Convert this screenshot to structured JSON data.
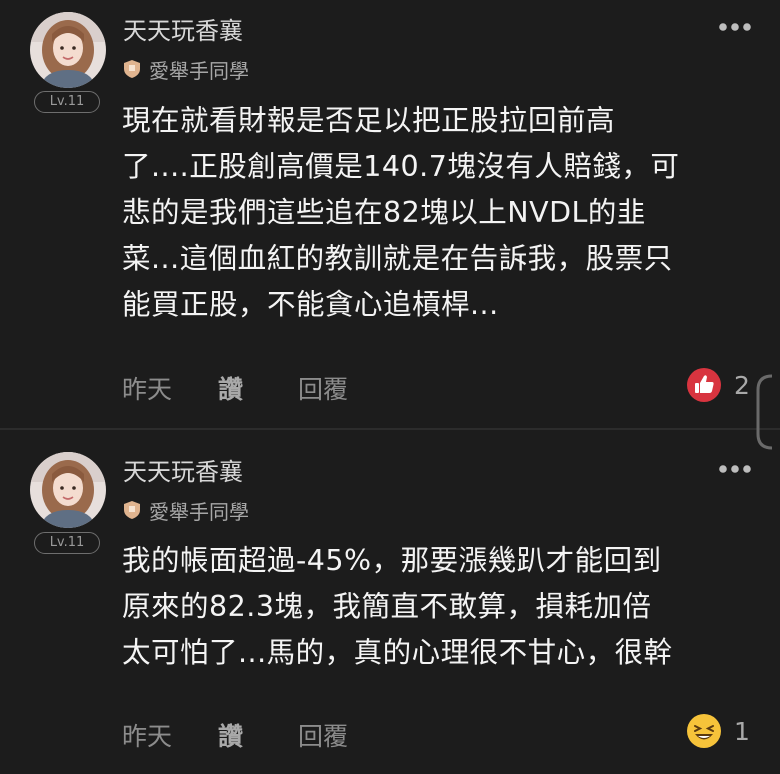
{
  "comments": [
    {
      "author": "天天玩香襄",
      "school": "愛舉手同學",
      "level": "Lv.11",
      "text": "現在就看財報是否足以把正股拉回前高\n了....正股創高價是140.7塊沒有人賠錢，可\n悲的是我們這些追在82塊以上NVDL的韭\n菜...這個血紅的教訓就是在告訴我，股票只\n能買正股，不能貪心追槓桿...",
      "time": "昨天",
      "like_label": "讚",
      "reply_label": "回覆",
      "reaction_icon": "thumbs-up-icon",
      "reaction_color": "#d8343f",
      "reaction_count": "2"
    },
    {
      "author": "天天玩香襄",
      "school": "愛舉手同學",
      "level": "Lv.11",
      "text": "我的帳面超過-45%，那要漲幾趴才能回到\n原來的82.3塊，我簡直不敢算，損耗加倍\n太可怕了...馬的，真的心理很不甘心，很幹",
      "time": "昨天",
      "like_label": "讚",
      "reply_label": "回覆",
      "reaction_icon": "laughing-face-icon",
      "reaction_color": "#f6c33a",
      "reaction_count": "1"
    }
  ],
  "colors": {
    "background": "#1c1c1c",
    "text": "#f4f4f4",
    "muted": "#8c8c8c",
    "badge_border": "#6e6e6e"
  }
}
